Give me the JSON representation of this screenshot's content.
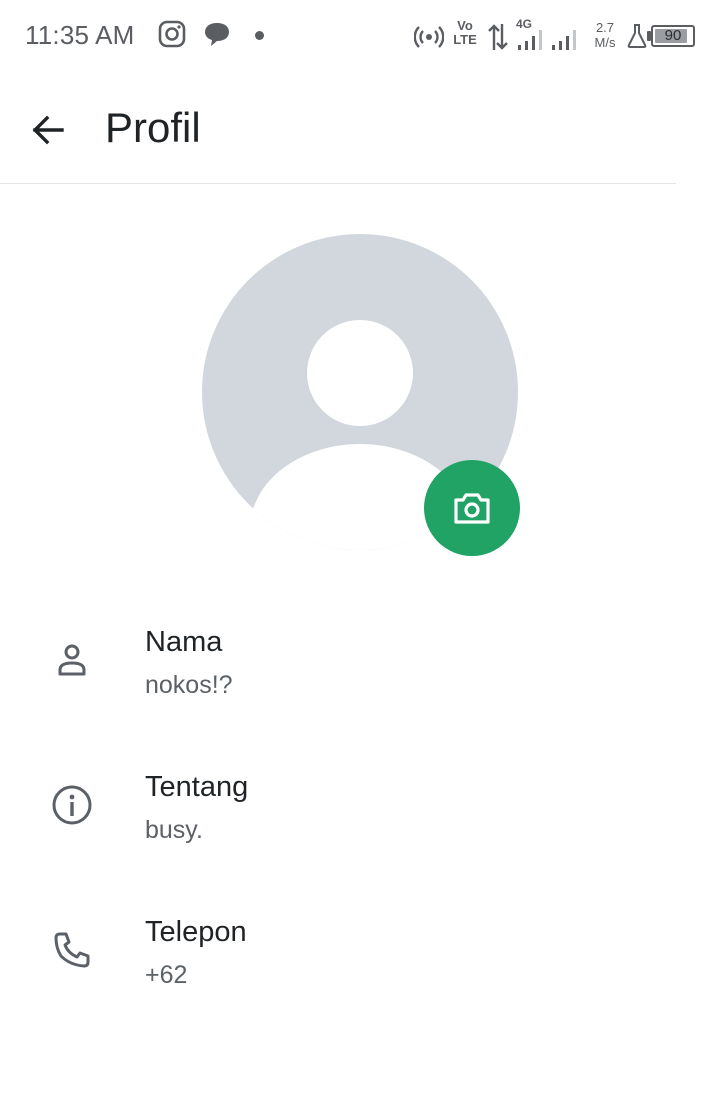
{
  "status_bar": {
    "time": "11:35 AM",
    "volte_line1": "Vo",
    "volte_line2": "LTE",
    "network_type": "4G",
    "speed_value": "2.7",
    "speed_unit": "M/s",
    "battery_level": "90",
    "icons": [
      "instagram-icon",
      "chat-icon",
      "notification-dot",
      "hotspot-icon",
      "data-arrows-icon",
      "signal-icon",
      "signal-icon",
      "flask-icon",
      "battery-icon"
    ]
  },
  "app_bar": {
    "back_icon": "arrow-left-icon",
    "title": "Profil"
  },
  "avatar": {
    "camera_icon": "camera-icon",
    "accent_color": "#21a366"
  },
  "fields": [
    {
      "icon": "person-icon",
      "label": "Nama",
      "value": "nokos!?"
    },
    {
      "icon": "info-icon",
      "label": "Tentang",
      "value": "busy."
    },
    {
      "icon": "phone-icon",
      "label": "Telepon",
      "value": "+62"
    }
  ]
}
